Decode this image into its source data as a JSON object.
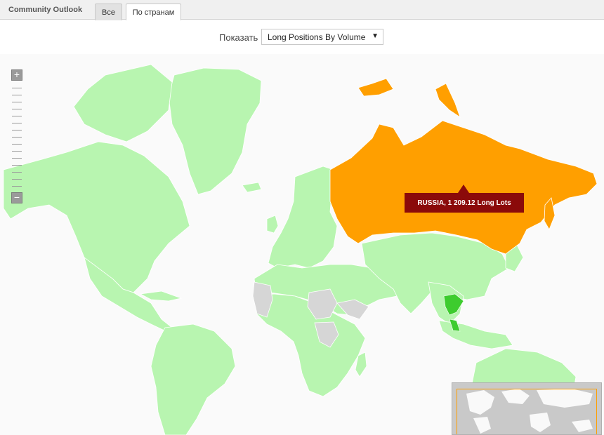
{
  "app": {
    "title": "Community Outlook"
  },
  "tabs": [
    {
      "label": "Все",
      "active": false
    },
    {
      "label": "По странам",
      "active": true
    }
  ],
  "toolbar": {
    "show_label": "Показать",
    "selected_option": "Long Positions By Volume"
  },
  "map": {
    "highlighted_country": "RUSSIA",
    "tooltip_text": "RUSSIA, 1 209.12 Long Lots",
    "colors": {
      "highlight": "#ff9f00",
      "land_default": "#b8f5b0",
      "land_active": "#3dcc2e",
      "no_data": "#d6d6d6",
      "tooltip_bg": "#8b0a0a"
    },
    "zoom_controls": {
      "zoom_in_icon": "plus-icon",
      "zoom_out_icon": "minus-icon"
    }
  }
}
